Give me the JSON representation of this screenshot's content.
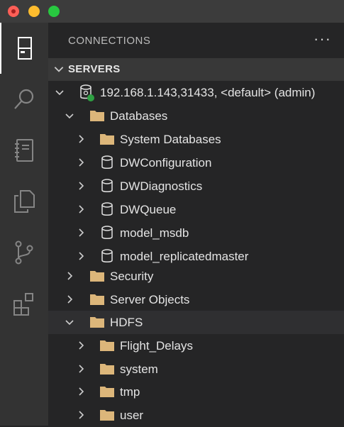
{
  "window": {
    "controls": [
      "close",
      "minimize",
      "maximize"
    ]
  },
  "activity_bar": {
    "items": [
      {
        "icon": "connections-icon",
        "active": true
      },
      {
        "icon": "search-icon"
      },
      {
        "icon": "notebook-icon"
      },
      {
        "icon": "copy-icon"
      },
      {
        "icon": "source-control-icon"
      },
      {
        "icon": "extensions-icon"
      }
    ]
  },
  "panel": {
    "title": "CONNECTIONS",
    "more": "···"
  },
  "servers": {
    "section_title": "SERVERS",
    "server_label": "192.168.1.143,31433, <default> (admin)",
    "databases_label": "Databases",
    "databases": [
      "System Databases",
      "DWConfiguration",
      "DWDiagnostics",
      "DWQueue",
      "model_msdb",
      "model_replicatedmaster"
    ],
    "security_label": "Security",
    "server_objects_label": "Server Objects",
    "hdfs_label": "HDFS",
    "hdfs_items": [
      "Flight_Delays",
      "system",
      "tmp",
      "user"
    ]
  },
  "colors": {
    "folder": "#dcb67a",
    "status_connected": "#2ea043",
    "background": "#252526",
    "activity_bar": "#333333"
  }
}
